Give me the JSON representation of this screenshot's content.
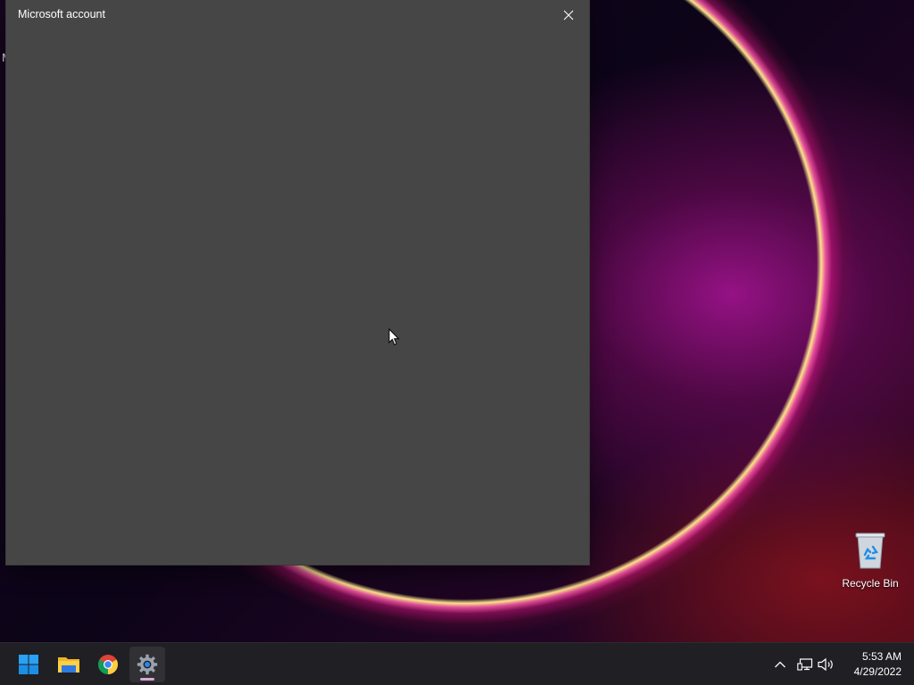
{
  "desktop": {
    "cut_off_label": "M",
    "icons": [
      {
        "label": "Recycle Bin",
        "icon": "recycle-bin-icon"
      }
    ]
  },
  "window": {
    "title": "Microsoft account",
    "close_icon": "close-icon",
    "background": "#464646"
  },
  "taskbar": {
    "apps": [
      {
        "name": "Start",
        "icon": "windows-start-icon"
      },
      {
        "name": "File Explorer",
        "icon": "file-explorer-icon"
      },
      {
        "name": "Google Chrome",
        "icon": "chrome-icon"
      },
      {
        "name": "Settings",
        "icon": "settings-gear-icon",
        "active": true
      }
    ],
    "tray": {
      "overflow_icon": "chevron-up-icon",
      "network_icon": "network-icon",
      "volume_icon": "volume-icon"
    },
    "clock": {
      "time": "5:53 AM",
      "date": "4/29/2022"
    }
  },
  "colors": {
    "taskbar": "#1f1f24",
    "accent_indicator": "#d8a8d8",
    "start_blue": "#1e90ff"
  }
}
